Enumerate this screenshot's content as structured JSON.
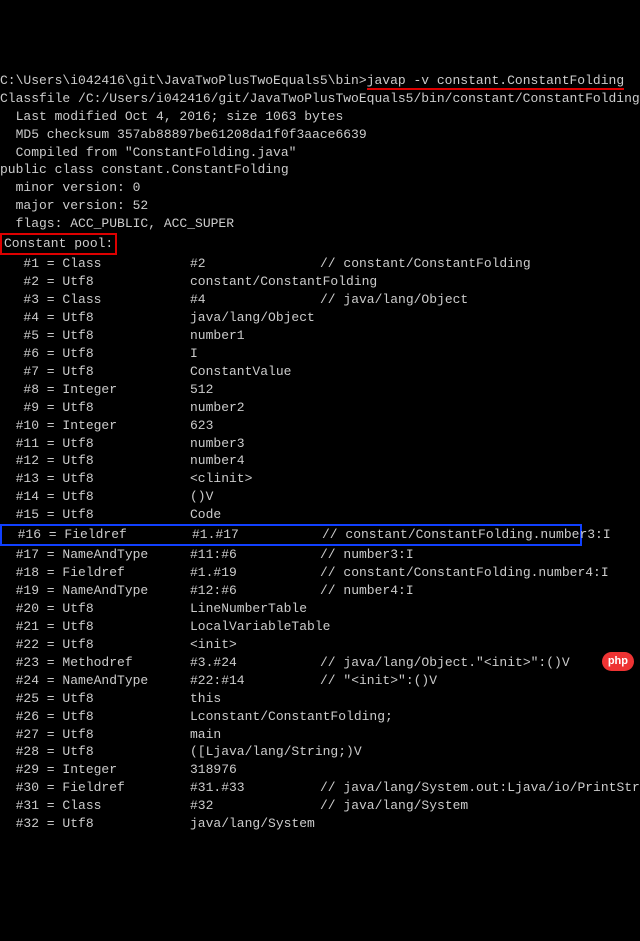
{
  "prompt": {
    "path": "C:\\Users\\i042416\\git\\JavaTwoPlusTwoEquals5\\bin>",
    "command": "javap -v constant.ConstantFolding"
  },
  "header": {
    "classfile": "Classfile /C:/Users/i042416/git/JavaTwoPlusTwoEquals5/bin/constant/ConstantFolding.class",
    "lastModified": "  Last modified Oct 4, 2016; size 1063 bytes",
    "md5": "  MD5 checksum 357ab88897be61208da1f0f3aace6639",
    "compiled": "  Compiled from \"ConstantFolding.java\"",
    "decl": "public class constant.ConstantFolding",
    "minor": "  minor version: 0",
    "major": "  major version: 52",
    "flags": "  flags: ACC_PUBLIC, ACC_SUPER",
    "pool": "Constant pool:"
  },
  "pool": [
    {
      "a": "   #1 = Class",
      "b": "#2",
      "c": "// constant/ConstantFolding"
    },
    {
      "a": "   #2 = Utf8",
      "b": "constant/ConstantFolding",
      "c": ""
    },
    {
      "a": "   #3 = Class",
      "b": "#4",
      "c": "// java/lang/Object"
    },
    {
      "a": "   #4 = Utf8",
      "b": "java/lang/Object",
      "c": ""
    },
    {
      "a": "   #5 = Utf8",
      "b": "number1",
      "c": ""
    },
    {
      "a": "   #6 = Utf8",
      "b": "I",
      "c": ""
    },
    {
      "a": "   #7 = Utf8",
      "b": "ConstantValue",
      "c": ""
    },
    {
      "a": "   #8 = Integer",
      "b": "512",
      "c": ""
    },
    {
      "a": "   #9 = Utf8",
      "b": "number2",
      "c": ""
    },
    {
      "a": "  #10 = Integer",
      "b": "623",
      "c": ""
    },
    {
      "a": "  #11 = Utf8",
      "b": "number3",
      "c": ""
    },
    {
      "a": "  #12 = Utf8",
      "b": "number4",
      "c": ""
    },
    {
      "a": "  #13 = Utf8",
      "b": "<clinit>",
      "c": ""
    },
    {
      "a": "  #14 = Utf8",
      "b": "()V",
      "c": ""
    },
    {
      "a": "  #15 = Utf8",
      "b": "Code",
      "c": ""
    },
    {
      "a": "  #16 = Fieldref",
      "b": "#1.#17",
      "c": "// constant/ConstantFolding.number3:I",
      "hl": "blue"
    },
    {
      "a": "  #17 = NameAndType",
      "b": "#11:#6",
      "c": "// number3:I"
    },
    {
      "a": "  #18 = Fieldref",
      "b": "#1.#19",
      "c": "// constant/ConstantFolding.number4:I"
    },
    {
      "a": "  #19 = NameAndType",
      "b": "#12:#6",
      "c": "// number4:I"
    },
    {
      "a": "  #20 = Utf8",
      "b": "LineNumberTable",
      "c": ""
    },
    {
      "a": "  #21 = Utf8",
      "b": "LocalVariableTable",
      "c": ""
    },
    {
      "a": "  #22 = Utf8",
      "b": "<init>",
      "c": ""
    },
    {
      "a": "  #23 = Methodref",
      "b": "#3.#24",
      "c": "// java/lang/Object.\"<init>\":()V"
    },
    {
      "a": "  #24 = NameAndType",
      "b": "#22:#14",
      "c": "// \"<init>\":()V"
    },
    {
      "a": "  #25 = Utf8",
      "b": "this",
      "c": ""
    },
    {
      "a": "  #26 = Utf8",
      "b": "Lconstant/ConstantFolding;",
      "c": ""
    },
    {
      "a": "  #27 = Utf8",
      "b": "main",
      "c": ""
    },
    {
      "a": "  #28 = Utf8",
      "b": "([Ljava/lang/String;)V",
      "c": ""
    },
    {
      "a": "  #29 = Integer",
      "b": "318976",
      "c": ""
    },
    {
      "a": "  #30 = Fieldref",
      "b": "#31.#33",
      "c": "// java/lang/System.out:Ljava/io/PrintStream;"
    },
    {
      "a": "  #31 = Class",
      "b": "#32",
      "c": "// java/lang/System"
    },
    {
      "a": "  #32 = Utf8",
      "b": "java/lang/System",
      "c": ""
    }
  ],
  "watermark": "php"
}
